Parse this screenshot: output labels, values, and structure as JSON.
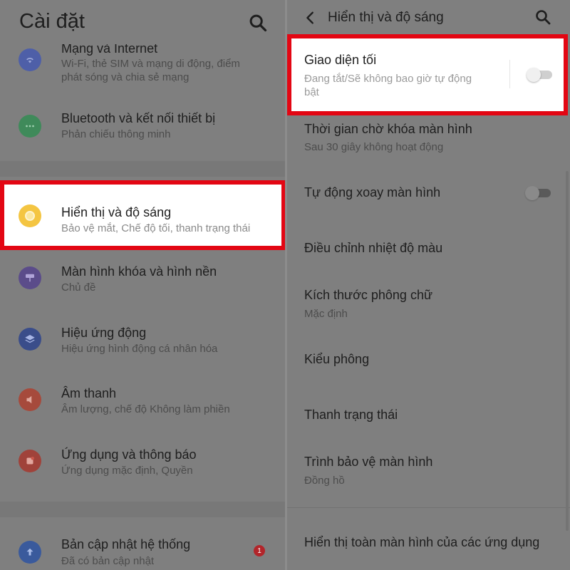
{
  "left": {
    "title": "Cài đặt",
    "items": [
      {
        "title": "Mạng và Internet",
        "sub1": "Wi-Fi, thẻ SIM và mạng di động, điểm",
        "sub2": "phát sóng và chia sẻ mạng",
        "icon": "wifi-icon",
        "color": "#4e5fa8"
      },
      {
        "title": "Bluetooth và kết nối thiết bị",
        "sub1": "Phản chiếu thông minh",
        "icon": "bluetooth-icon",
        "color": "#3f8a5a"
      },
      {
        "title": "Hiển thị và độ sáng",
        "sub1": "Bảo vệ mắt, Chế độ tối, thanh trạng thái",
        "icon": "brightness-icon",
        "color": "#f4c542"
      },
      {
        "title": "Màn hình khóa và hình nền",
        "sub1": "Chủ đề",
        "icon": "paint-roller-icon",
        "color": "#5b4c8a"
      },
      {
        "title": "Hiệu ứng động",
        "sub1": "Hiệu ứng hình động cá nhân hóa",
        "icon": "layers-icon",
        "color": "#3a4d8a"
      },
      {
        "title": "Âm thanh",
        "sub1": "Âm lượng, chế độ Không làm phiền",
        "icon": "speaker-icon",
        "color": "#a64a3c"
      },
      {
        "title": "Ứng dụng và thông báo",
        "sub1": "Ứng dụng mặc định, Quyền",
        "icon": "apps-icon",
        "color": "#a0423a"
      },
      {
        "title": "Bản cập nhật hệ thống",
        "sub1": "Đã có bản cập nhật",
        "icon": "update-arrow-icon",
        "color": "#3a5a9c",
        "badge": "1"
      }
    ]
  },
  "right": {
    "title": "Hiển thị và độ sáng",
    "dark_mode": {
      "title": "Giao diện tối",
      "subtitle": "Đang tắt/Sẽ không bao giờ tự động bật",
      "enabled": false
    },
    "items": [
      {
        "title": "Thời gian chờ khóa màn hình",
        "sub": "Sau 30 giây không hoạt động"
      },
      {
        "title": "Tự động xoay màn hình",
        "toggle": false
      },
      {
        "title": "Điều chỉnh nhiệt độ màu"
      },
      {
        "title": "Kích thước phông chữ",
        "sub": "Mặc định"
      },
      {
        "title": "Kiểu phông"
      },
      {
        "title": "Thanh trạng thái"
      },
      {
        "title": "Trình bảo vệ màn hình",
        "sub": "Đồng hồ"
      },
      {
        "title": "Hiển thị toàn màn hình của các ứng dụng"
      }
    ]
  },
  "colors": {
    "highlight_border": "#e30613",
    "dim_overlay": "#7f7f7f"
  }
}
